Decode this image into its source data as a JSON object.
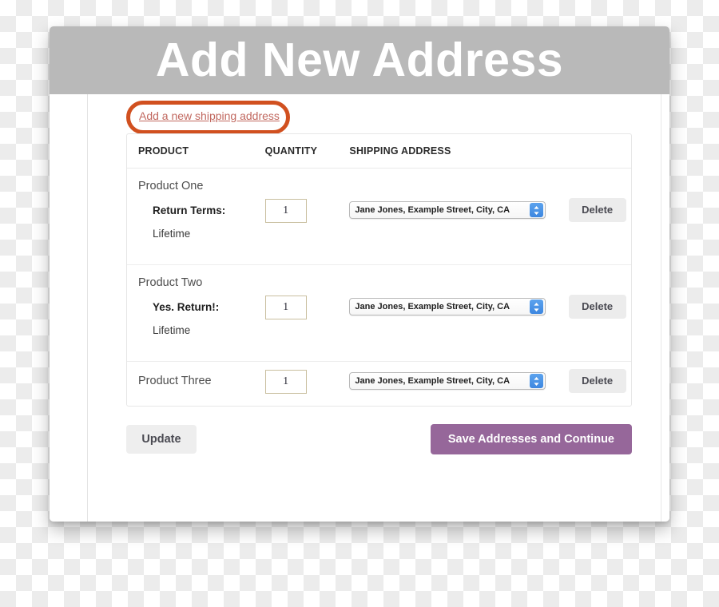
{
  "window": {
    "title": "Add New Address"
  },
  "annotation": {
    "link_label": "Add a new shipping address",
    "ellipse_color": "#d1501f",
    "link_color": "#c1685f"
  },
  "table": {
    "headers": {
      "product": "PRODUCT",
      "quantity": "QUANTITY",
      "address": "SHIPPING ADDRESS",
      "action": ""
    },
    "rows": [
      {
        "product": "Product One",
        "return_label": "Return Terms:",
        "return_value": "Lifetime",
        "quantity": "1",
        "address": "Jane Jones, Example Street, City, CA",
        "delete_label": "Delete"
      },
      {
        "product": "Product Two",
        "return_label": "Yes. Return!:",
        "return_value": "Lifetime",
        "quantity": "1",
        "address": "Jane Jones, Example Street, City, CA",
        "delete_label": "Delete"
      },
      {
        "product": "Product Three",
        "return_label": "",
        "return_value": "",
        "quantity": "1",
        "address": "Jane Jones, Example Street, City, CA",
        "delete_label": "Delete"
      }
    ]
  },
  "footer": {
    "update_label": "Update",
    "save_label": "Save Addresses and Continue",
    "save_color": "#96679a"
  },
  "icons": {
    "stepper": "updown-chevron-icon"
  }
}
